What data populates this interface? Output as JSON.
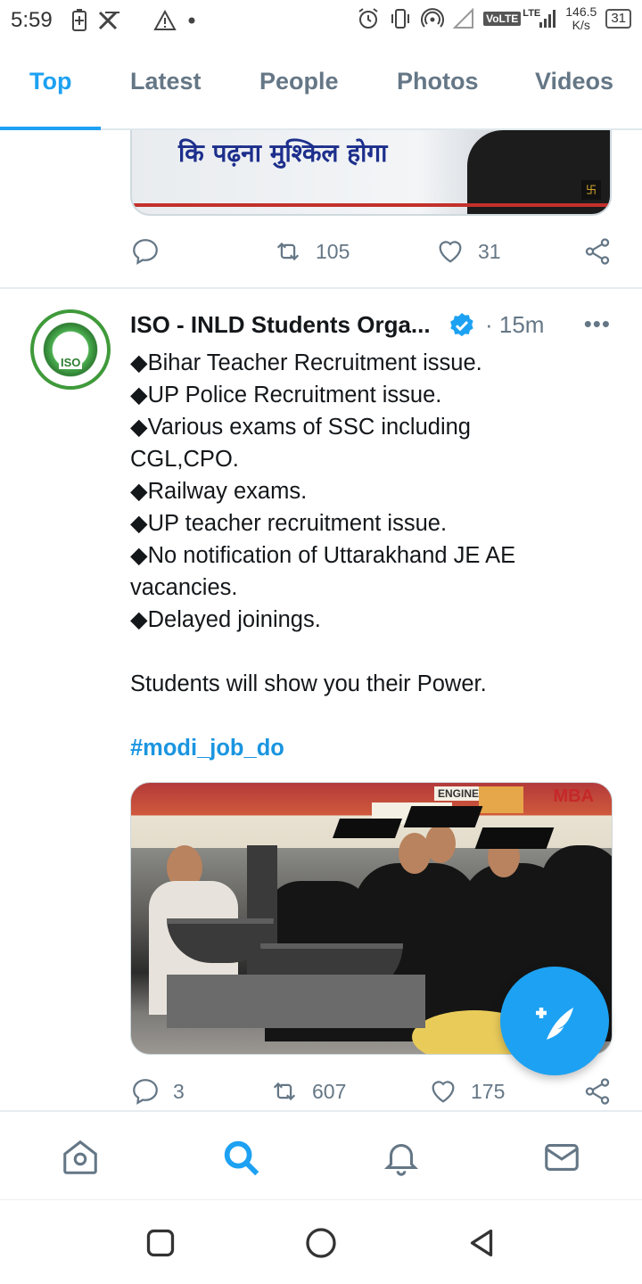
{
  "status_bar": {
    "time": "5:59",
    "network_type": "VoLTE",
    "lte_label": "LTE",
    "speed_value": "146.5",
    "speed_unit": "K/s",
    "battery": "31"
  },
  "tabs": [
    {
      "label": "Top",
      "active": true
    },
    {
      "label": "Latest",
      "active": false
    },
    {
      "label": "People",
      "active": false
    },
    {
      "label": "Photos",
      "active": false
    },
    {
      "label": "Videos",
      "active": false
    }
  ],
  "previous_tweet": {
    "media_caption": "कि पढ़ना मुश्किल होगा",
    "actions": {
      "reply_count": "",
      "retweet_count": "105",
      "like_count": "31"
    }
  },
  "tweet": {
    "author": "ISO - INLD Students Orga...",
    "avatar_text": "ISO",
    "time": "· 15m",
    "more_label": "•••",
    "lines": [
      "◆Bihar Teacher Recruitment issue.",
      "◆UP Police Recruitment issue.",
      "◆Various exams of SSC including",
      "CGL,CPO.",
      "◆Railway exams.",
      "◆UP teacher recruitment issue.",
      "◆No notification of Uttarakhand JE AE",
      "vacancies.",
      "◆Delayed joinings."
    ],
    "closing": "Students will show you their Power.",
    "hashtag": "#modi_job_do",
    "photo_signs": {
      "mba": "MBA",
      "engineer": "ENGINEER"
    },
    "actions": {
      "reply_count": "3",
      "retweet_count": "607",
      "like_count": "175"
    }
  },
  "colors": {
    "accent": "#1da1f2",
    "muted": "#657786",
    "text": "#14171a",
    "divider": "#e6ecf0"
  },
  "bottom_nav": [
    "home-icon",
    "search-icon",
    "notifications-icon",
    "messages-icon"
  ],
  "system_nav": [
    "recents-icon",
    "home-circle-icon",
    "back-icon"
  ]
}
